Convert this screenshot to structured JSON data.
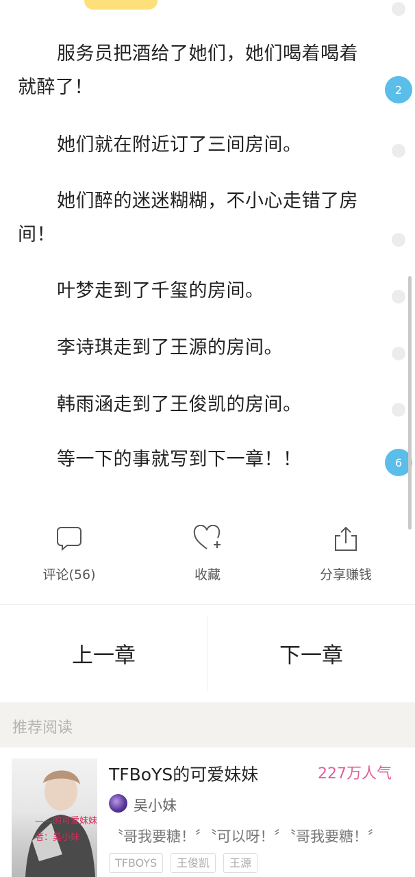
{
  "paragraphs": [
    "服务员把酒给了她们，她们喝着喝着就醉了！",
    "她们就在附近订了三间房间。",
    "她们醉的迷迷糊糊，不小心走错了房间！",
    "叶梦走到了千玺的房间。",
    "李诗琪走到了王源的房间。",
    "韩雨涵走到了王俊凯的房间。",
    "等一下的事就写到下一章！！"
  ],
  "paragraph_comment_counts": [
    "2",
    "6"
  ],
  "actions": {
    "comment_label": "评论(56)",
    "favorite_label": "收藏",
    "share_label": "分享赚钱"
  },
  "chapter_nav": {
    "prev_label": "上一章",
    "next_label": "下一章"
  },
  "recommend": {
    "header": "推荐阅读",
    "book": {
      "title": "TFBoYS的可爱妹妹",
      "popularity": "227万人气",
      "author": "吴小妹",
      "snippet": "〝哥我要糖！〞〝可以呀！〞〝哥我要糖！〞",
      "tags": [
        "TFBOYS",
        "王俊凯",
        "王源"
      ],
      "cover_text_line1": "——的可爱妹妹",
      "cover_text_line2": "者：吴小妹"
    }
  },
  "colors": {
    "accent_blue": "#5bbde9",
    "popularity_pink": "#e0609a",
    "top_pill_yellow": "#fde07a"
  }
}
